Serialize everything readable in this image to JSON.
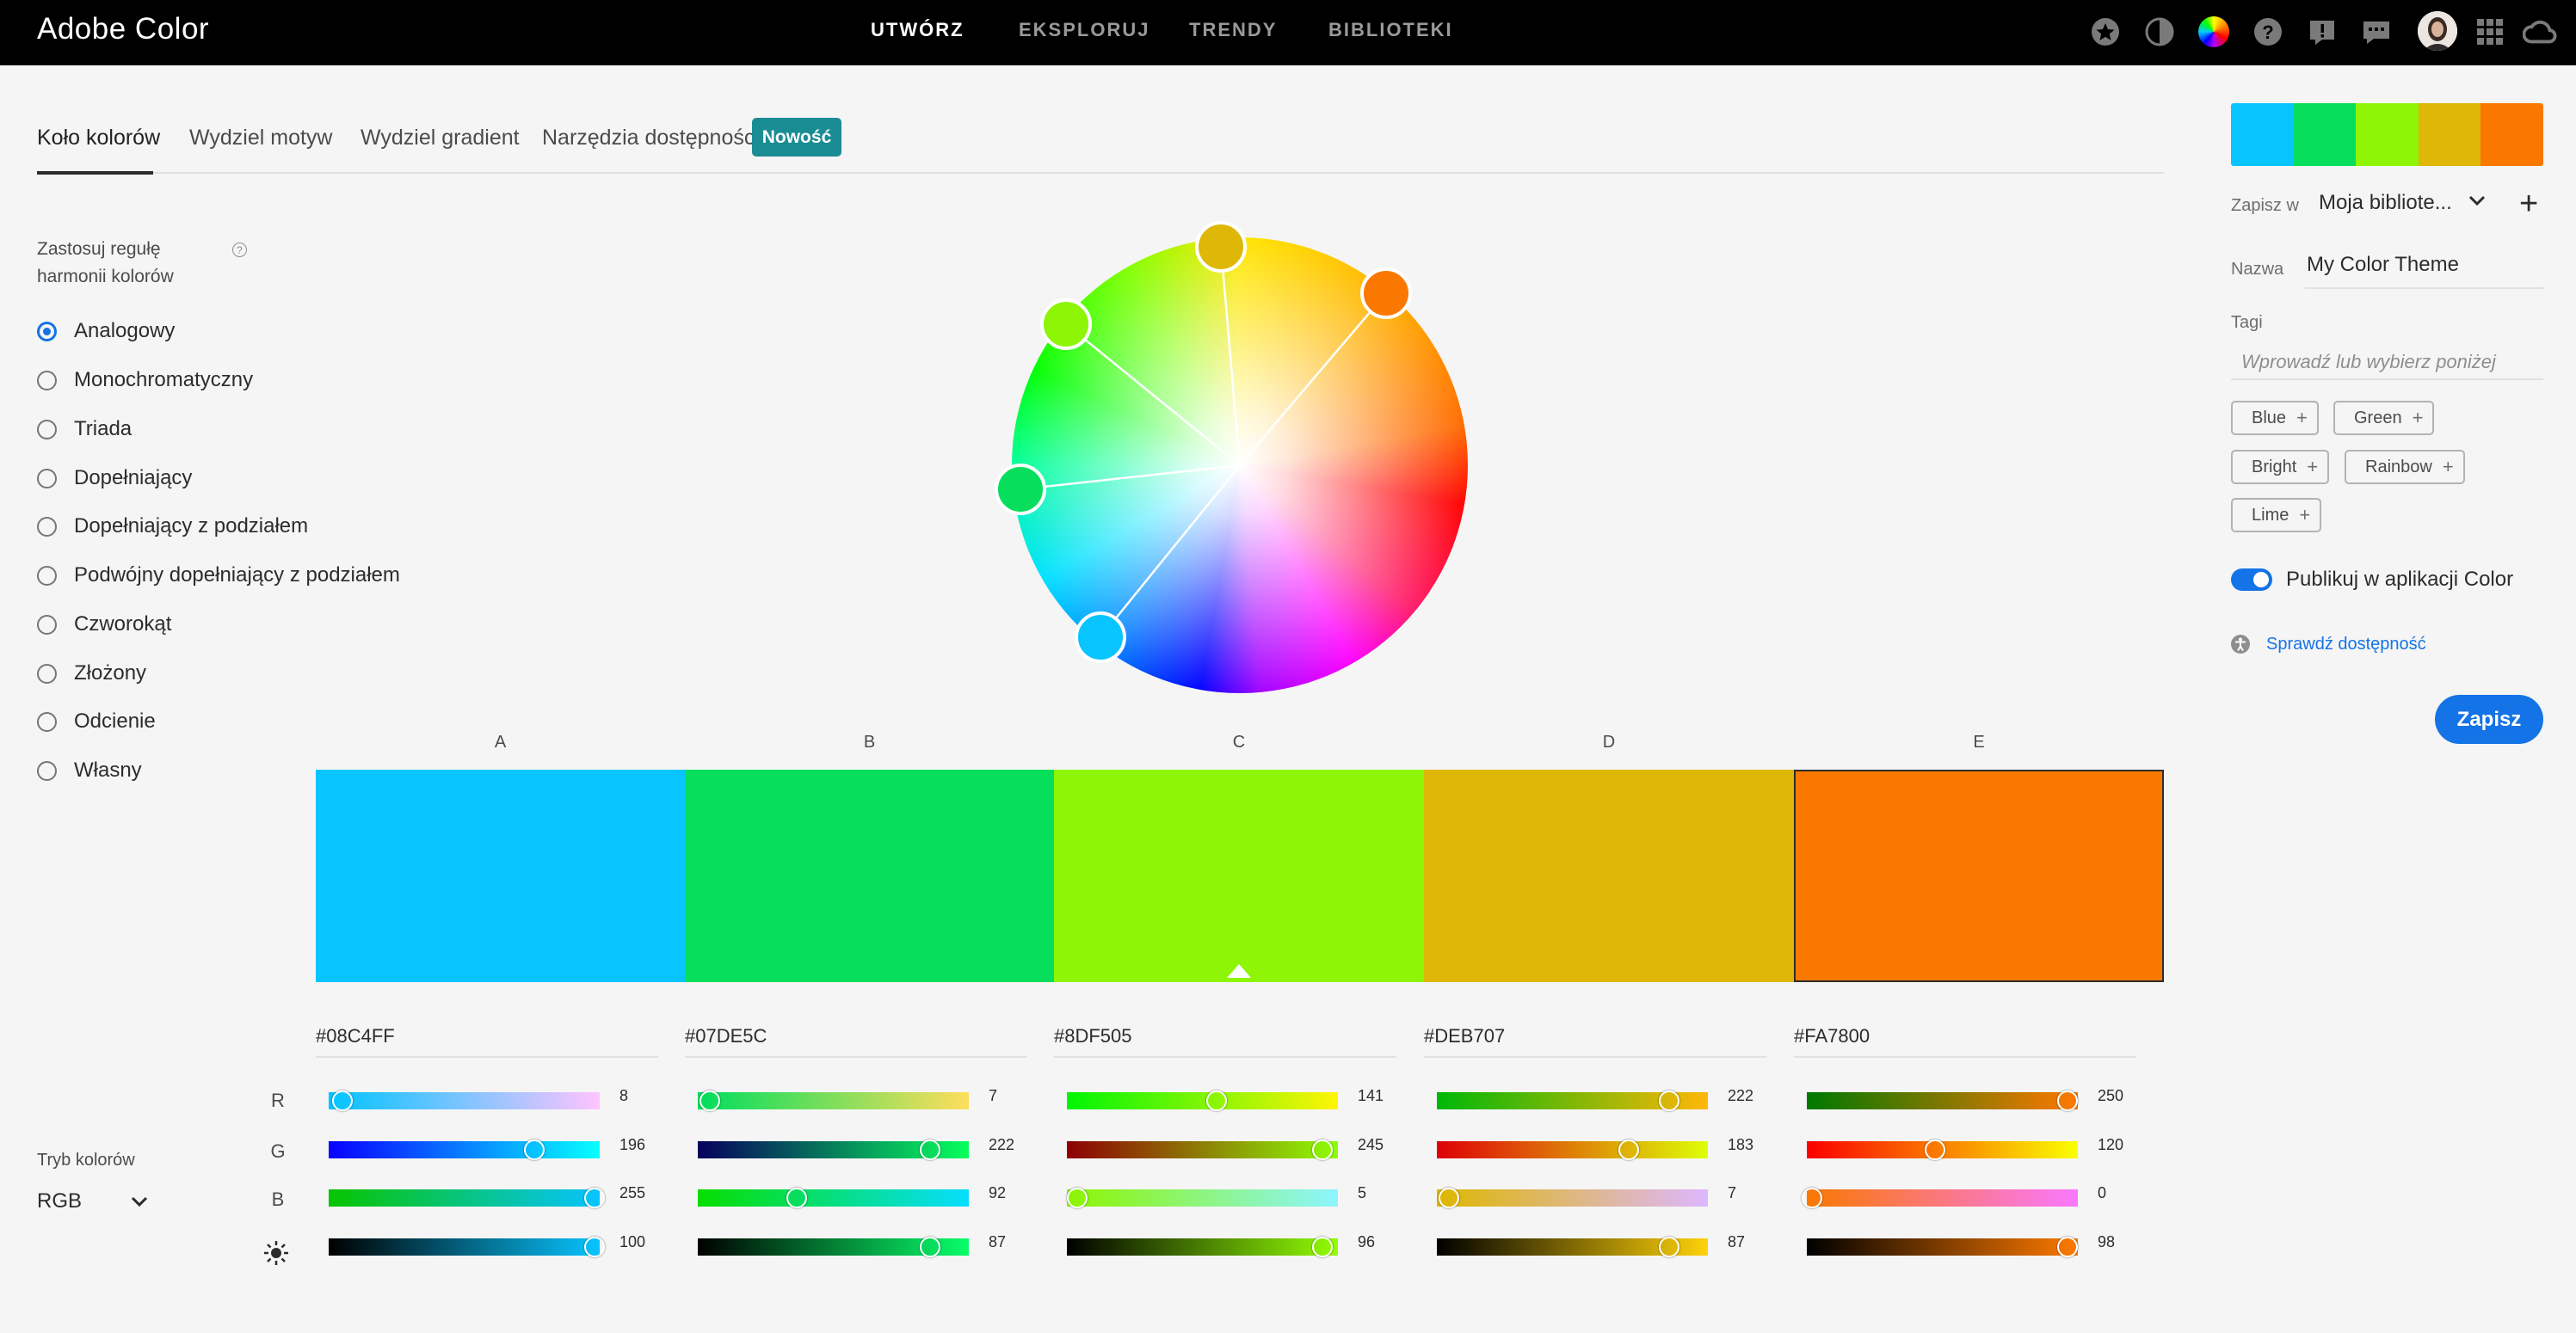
{
  "app": {
    "title": "Adobe Color"
  },
  "topnav": {
    "items": [
      "UTWÓRZ",
      "EKSPLORUJ",
      "TRENDY",
      "BIBLIOTEKI"
    ],
    "active": "UTWÓRZ"
  },
  "topicons": [
    "star-icon",
    "contrast-icon",
    "color-wheel-icon",
    "help-icon",
    "feedback-icon",
    "chat-icon",
    "avatar",
    "apps-grid-icon",
    "creative-cloud-icon"
  ],
  "tabs": [
    "Koło kolorów",
    "Wydziel motyw",
    "Wydziel gradient",
    "Narzędzia dostępności"
  ],
  "new_badge": "Nowość",
  "harmony": {
    "label": "Zastosuj regułę harmonii kolorów",
    "selected": "Analogowy",
    "options": [
      "Analogowy",
      "Monochromatyczny",
      "Triada",
      "Dopełniający",
      "Dopełniający z podziałem",
      "Podwójny dopełniający z podziałem",
      "Czworokąt",
      "Złożony",
      "Odcienie",
      "Własny"
    ]
  },
  "colors": [
    {
      "label": "A",
      "hex": "#08C4FF",
      "color": "#08c4ff",
      "r": "8",
      "g": "196",
      "b": "255",
      "br": "100"
    },
    {
      "label": "B",
      "hex": "#07DE5C",
      "color": "#07de5c",
      "r": "7",
      "g": "222",
      "b": "92",
      "br": "87"
    },
    {
      "label": "C",
      "hex": "#8DF505",
      "color": "#8df505",
      "r": "141",
      "g": "245",
      "b": "5",
      "br": "96"
    },
    {
      "label": "D",
      "hex": "#DEB707",
      "color": "#deb707",
      "r": "222",
      "g": "183",
      "b": "7",
      "br": "87"
    },
    {
      "label": "E",
      "hex": "#FA7800",
      "color": "#fa7800",
      "r": "250",
      "g": "120",
      "b": "0",
      "br": "98"
    }
  ],
  "channel_labels": [
    "R",
    "G",
    "B"
  ],
  "brightness_icon": "brightness-icon",
  "color_mode": {
    "label": "Tryb kolorów",
    "value": "RGB"
  },
  "panel": {
    "save_in_label": "Zapisz w",
    "library": "Moja bibliote...",
    "name_label": "Nazwa",
    "name_value": "My Color Theme",
    "tags_label": "Tagi",
    "tags_placeholder": "Wprowadź lub wybierz poniżej",
    "tags": [
      "Blue",
      "Green",
      "Bright",
      "Rainbow",
      "Lime"
    ],
    "publish_label": "Publikuj w aplikacji Color",
    "publish_on": true,
    "a11y_link": "Sprawdź dostępność",
    "save_button": "Zapisz"
  }
}
